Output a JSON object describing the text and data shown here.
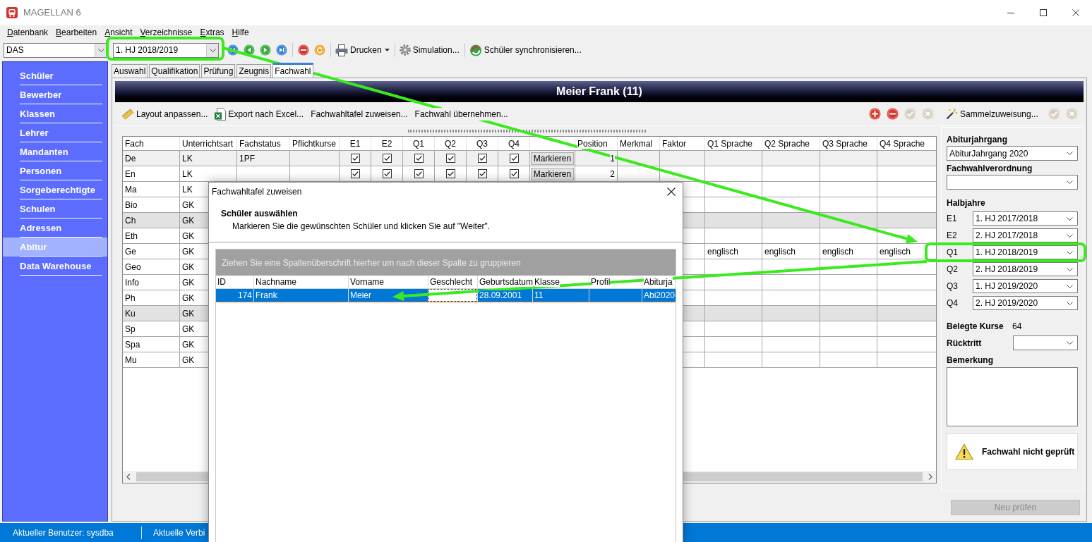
{
  "window": {
    "title": "MAGELLAN 6"
  },
  "menu": [
    {
      "label": "Datenbank"
    },
    {
      "label": "Bearbeiten"
    },
    {
      "label": "Ansicht"
    },
    {
      "label": "Verzeichnisse"
    },
    {
      "label": "Extras"
    },
    {
      "label": "Hilfe"
    }
  ],
  "toolbar": {
    "database": "DAS",
    "semester": "1. HJ 2018/2019",
    "nav_buttons": [
      {
        "kind": "first"
      },
      {
        "kind": "previous"
      },
      {
        "kind": "next"
      },
      {
        "kind": "last"
      }
    ],
    "record_buttons": [
      {
        "kind": "delete"
      },
      {
        "kind": "refresh"
      }
    ],
    "tools": [
      {
        "kind": "print",
        "label": "Drucken",
        "dropdown": true
      },
      {
        "kind": "simulation",
        "label": "Simulation..."
      },
      {
        "kind": "sync",
        "label": "Schüler synchronisieren..."
      }
    ]
  },
  "sidebar": {
    "items": [
      {
        "label": "Schüler",
        "selected": false
      },
      {
        "label": "Bewerber",
        "selected": false
      },
      {
        "label": "Klassen",
        "selected": false
      },
      {
        "label": "Lehrer",
        "selected": false
      },
      {
        "label": "Mandanten",
        "selected": false
      },
      {
        "label": "Personen",
        "selected": false
      },
      {
        "label": "Sorgeberechtigte",
        "selected": false
      },
      {
        "label": "Schulen",
        "selected": false
      },
      {
        "label": "Adressen",
        "selected": false
      },
      {
        "label": "Abitur",
        "selected": true
      },
      {
        "label": "Data Warehouse",
        "selected": false
      }
    ]
  },
  "tabs": [
    {
      "label": "Auswahl",
      "selected": false
    },
    {
      "label": "Qualifikation",
      "selected": false
    },
    {
      "label": "Prüfung",
      "selected": false
    },
    {
      "label": "Zeugnis",
      "selected": false
    },
    {
      "label": "Fachwahl",
      "selected": true
    }
  ],
  "header": {
    "title": "Meier Frank (11)"
  },
  "actions": [
    {
      "kind": "layout",
      "label": "Layout anpassen..."
    },
    {
      "kind": "excel",
      "label": "Export nach Excel..."
    },
    {
      "kind": "plain",
      "label": "Fachwahltafel zuweisen..."
    },
    {
      "kind": "plain",
      "label": "Fachwahl übernehmen..."
    }
  ],
  "row_buttons": [
    {
      "kind": "add",
      "disabled": false
    },
    {
      "kind": "remove",
      "disabled": false
    },
    {
      "kind": "confirm",
      "disabled": true
    },
    {
      "kind": "cancel",
      "disabled": true
    }
  ],
  "table": {
    "columns": [
      {
        "kind": "text",
        "label": "Fach"
      },
      {
        "kind": "text",
        "label": "Unterrichtsart"
      },
      {
        "kind": "text",
        "label": "Fachstatus"
      },
      {
        "kind": "text",
        "label": "Pflichtkurse"
      },
      {
        "kind": "check",
        "label": "E1"
      },
      {
        "kind": "check",
        "label": "E2"
      },
      {
        "kind": "check",
        "label": "Q1"
      },
      {
        "kind": "check",
        "label": "Q2"
      },
      {
        "kind": "check",
        "label": "Q3"
      },
      {
        "kind": "check",
        "label": "Q4"
      },
      {
        "kind": "button"
      },
      {
        "kind": "number",
        "label": "Position"
      },
      {
        "kind": "text",
        "label": "Merkmal"
      },
      {
        "kind": "text",
        "label": "Faktor"
      },
      {
        "kind": "text",
        "label": "Q1 Sprache"
      },
      {
        "kind": "text",
        "label": "Q2 Sprache"
      },
      {
        "kind": "text",
        "label": "Q3 Sprache"
      },
      {
        "kind": "text",
        "label": "Q4 Sprache"
      }
    ],
    "rows": [
      {
        "selected": true,
        "highlighted": false,
        "cells": [
          "De",
          "LK",
          "1PF",
          null,
          {
            "checked": true
          },
          {
            "checked": true
          },
          {
            "checked": true
          },
          {
            "checked": true
          },
          {
            "checked": true
          },
          {
            "checked": true
          },
          "Markieren",
          "1",
          null,
          null,
          null,
          null,
          null,
          null
        ]
      },
      {
        "selected": false,
        "highlighted": false,
        "cells": [
          "En",
          "LK",
          null,
          null,
          {
            "checked": true
          },
          {
            "checked": true
          },
          {
            "checked": true
          },
          {
            "checked": true
          },
          {
            "checked": true
          },
          {
            "checked": true
          },
          "Markieren",
          "2",
          null,
          null,
          null,
          null,
          null,
          null
        ]
      },
      {
        "selected": false,
        "highlighted": false,
        "cells": [
          "Ma",
          "LK",
          null,
          null,
          null,
          null,
          null,
          null,
          null,
          null,
          null,
          null,
          null,
          null,
          null,
          null,
          null,
          null
        ]
      },
      {
        "selected": false,
        "highlighted": false,
        "cells": [
          "Bio",
          "GK",
          null,
          null,
          null,
          null,
          null,
          null,
          null,
          null,
          null,
          null,
          null,
          null,
          null,
          null,
          null,
          null
        ]
      },
      {
        "selected": false,
        "highlighted": true,
        "cells": [
          "Ch",
          "GK",
          null,
          null,
          null,
          null,
          null,
          null,
          null,
          null,
          null,
          null,
          null,
          null,
          null,
          null,
          null,
          null
        ]
      },
      {
        "selected": false,
        "highlighted": false,
        "cells": [
          "Eth",
          "GK",
          null,
          null,
          null,
          null,
          null,
          null,
          null,
          null,
          null,
          null,
          null,
          null,
          null,
          null,
          null,
          null
        ]
      },
      {
        "selected": false,
        "highlighted": false,
        "cells": [
          "Ge",
          "GK",
          null,
          null,
          null,
          null,
          null,
          null,
          null,
          null,
          null,
          null,
          null,
          null,
          "englisch",
          "englisch",
          "englisch",
          "englisch"
        ]
      },
      {
        "selected": false,
        "highlighted": false,
        "cells": [
          "Geo",
          "GK",
          null,
          null,
          null,
          null,
          null,
          null,
          null,
          null,
          null,
          null,
          null,
          null,
          null,
          null,
          null,
          null
        ]
      },
      {
        "selected": false,
        "highlighted": false,
        "cells": [
          "Info",
          "GK",
          null,
          null,
          null,
          null,
          null,
          null,
          null,
          null,
          null,
          null,
          null,
          null,
          null,
          null,
          null,
          null
        ]
      },
      {
        "selected": false,
        "highlighted": false,
        "cells": [
          "Ph",
          "GK",
          null,
          null,
          null,
          null,
          null,
          null,
          null,
          null,
          null,
          null,
          null,
          null,
          null,
          null,
          null,
          null
        ]
      },
      {
        "selected": false,
        "highlighted": true,
        "cells": [
          "Ku",
          "GK",
          null,
          null,
          null,
          null,
          null,
          null,
          null,
          null,
          null,
          null,
          null,
          null,
          null,
          null,
          null,
          null
        ]
      },
      {
        "selected": false,
        "highlighted": false,
        "cells": [
          "Sp",
          "GK",
          null,
          null,
          null,
          null,
          null,
          null,
          null,
          null,
          null,
          null,
          null,
          null,
          null,
          null,
          null,
          null
        ]
      },
      {
        "selected": false,
        "highlighted": false,
        "cells": [
          "Spa",
          "GK",
          null,
          null,
          null,
          null,
          null,
          null,
          null,
          null,
          null,
          null,
          null,
          null,
          null,
          null,
          null,
          null
        ]
      },
      {
        "selected": false,
        "highlighted": false,
        "cells": [
          "Mu",
          "GK",
          null,
          null,
          null,
          null,
          null,
          null,
          null,
          null,
          null,
          null,
          null,
          null,
          null,
          null,
          null,
          null
        ]
      }
    ]
  },
  "side_panel": {
    "action": {
      "label": "Sammelzuweisung..."
    },
    "buttons": [
      {
        "kind": "confirm",
        "disabled": true
      },
      {
        "kind": "cancel",
        "disabled": true
      }
    ],
    "abiturjahrgang": {
      "label": "Abiturjahrgang",
      "value": "AbiturJahrgang 2020"
    },
    "fachwahlverordnung": {
      "label": "Fachwahlverordnung"
    },
    "halbjahre": {
      "label": "Halbjahre",
      "rows": [
        {
          "label": "E1",
          "value": "1. HJ 2017/2018"
        },
        {
          "label": "E2",
          "value": "2. HJ 2017/2018"
        },
        {
          "label": "Q1",
          "value": "1. HJ 2018/2019"
        },
        {
          "label": "Q2",
          "value": "2. HJ 2018/2019"
        },
        {
          "label": "Q3",
          "value": "1. HJ 2019/2020"
        },
        {
          "label": "Q4",
          "value": "2. HJ 2019/2020"
        }
      ]
    },
    "belegte_kurse": {
      "label": "Belegte Kurse",
      "value": "64"
    },
    "ruecktritt": {
      "label": "Rücktritt"
    },
    "bemerkung": {
      "label": "Bemerkung"
    },
    "check_status": {
      "kind": "warning",
      "text": "Fachwahl nicht geprüft"
    },
    "recheck_button": {
      "label": "Neu prüfen",
      "disabled": true
    }
  },
  "dialog": {
    "title": "Fachwahltafel zuweisen",
    "heading": "Schüler auswählen",
    "instruction": "Markieren Sie die gewünschten Schüler und klicken Sie auf \"Weiter\".",
    "group_hint": "Ziehen Sie eine Spaltenüberschrift hierher um nach dieser Spalte zu gruppieren",
    "columns": [
      "ID",
      "Nachname",
      "Vorname",
      "Geschlecht",
      "Geburtsdatum",
      "Klasse",
      "Profil",
      "Abiturja"
    ],
    "rows": [
      {
        "selected": true,
        "cells": [
          {
            "text": "174",
            "focused": false
          },
          {
            "text": "Frank",
            "focused": false
          },
          {
            "text": "Meier",
            "focused": false
          },
          {
            "focused": true
          },
          {
            "text": "28.09.2001",
            "focused": false
          },
          {
            "text": "11",
            "focused": false
          },
          {
            "focused": false
          },
          {
            "text": "Abi2020",
            "focused": false
          }
        ]
      }
    ]
  },
  "status_bar": {
    "items": [
      {
        "text": "Aktueller Benutzer: sysdba"
      },
      {
        "text": "Aktuelle Verbi"
      }
    ]
  }
}
